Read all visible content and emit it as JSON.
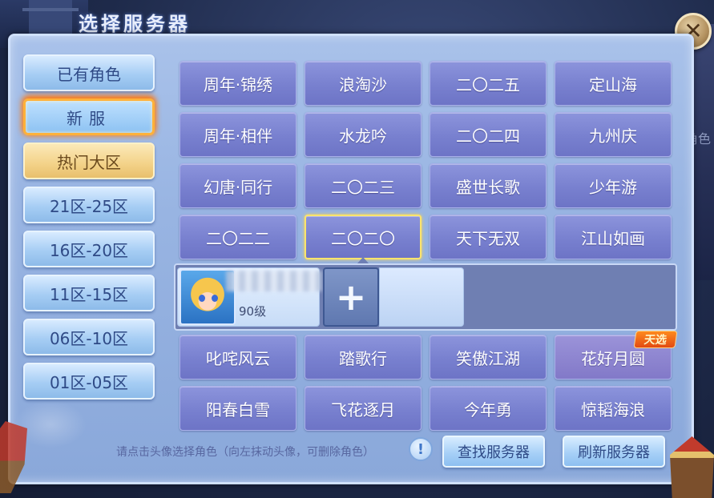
{
  "title": "选择服务器",
  "close": {
    "glyph": "✕"
  },
  "background": {
    "side_text": "角色"
  },
  "tabs": [
    {
      "label": "已有角色",
      "state": "normal"
    },
    {
      "label": "新服",
      "state": "active"
    },
    {
      "label": "热门大区",
      "state": "hot"
    },
    {
      "label": "21区-25区",
      "state": "normal"
    },
    {
      "label": "16区-20区",
      "state": "normal"
    },
    {
      "label": "11区-15区",
      "state": "normal"
    },
    {
      "label": "06区-10区",
      "state": "normal"
    },
    {
      "label": "01区-05区",
      "state": "normal"
    }
  ],
  "servers_top": [
    [
      "周年·锦绣",
      "浪淘沙",
      "二〇二五",
      "定山海"
    ],
    [
      "周年·相伴",
      "水龙吟",
      "二〇二四",
      "九州庆"
    ],
    [
      "幻唐·同行",
      "二〇二三",
      "盛世长歌",
      "少年游"
    ],
    [
      "二〇二二",
      "二〇二〇",
      "天下无双",
      "江山如画"
    ]
  ],
  "selected_server": "二〇二〇",
  "character": {
    "level": "90级",
    "add_glyph": "+"
  },
  "servers_bottom": [
    [
      "叱咤风云",
      "踏歌行",
      "笑傲江湖",
      "花好月圆"
    ],
    [
      "阳春白雪",
      "飞花逐月",
      "今年勇",
      "惊韬海浪"
    ]
  ],
  "featured_badge": "天选",
  "footer": {
    "hint": "请点击头像选择角色（向左抹动头像，可删除角色）",
    "hint_icon": "!",
    "find_button": "查找服务器",
    "refresh_button": "刷新服务器"
  },
  "colors": {
    "panel": "#98b4e2",
    "server_button": "#7880cf",
    "selected_border": "#ffe46b",
    "active_tab_glow": "#ff8a1e",
    "hot_tab": "#f3d288"
  }
}
